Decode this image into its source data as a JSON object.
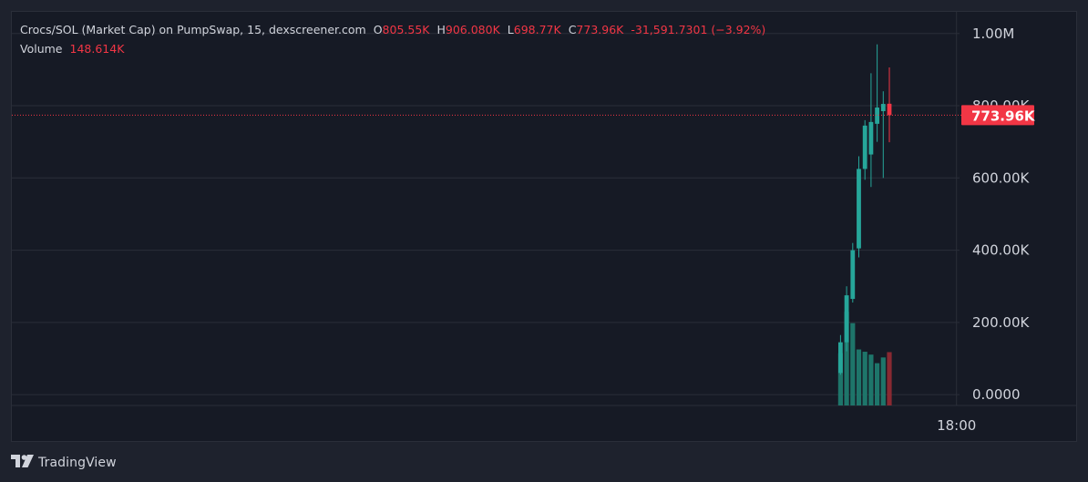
{
  "legend": {
    "title": "Crocs/SOL (Market Cap) on PumpSwap, 15, dexscreener.com",
    "open_label": "O",
    "open_value": "805.55K",
    "high_label": "H",
    "high_value": "906.080K",
    "low_label": "L",
    "low_value": "698.77K",
    "close_label": "C",
    "close_value": "773.96K",
    "change": "-31,591.7301 (−3.92%)",
    "volume_label": "Volume",
    "volume_value": "148.614K"
  },
  "price_tag": "773.96K",
  "footer": {
    "logo_icon": "tradingview-logo-icon",
    "brand": "TradingView"
  },
  "colors": {
    "background": "#161a25",
    "grid": "#2a2e39",
    "up": "#26a69a",
    "down": "#f23645",
    "axis_text": "#b2b5be"
  },
  "chart_data": {
    "type": "candlestick",
    "title": "Crocs/SOL (Market Cap) on PumpSwap, 15, dexscreener.com",
    "y_ticks": [
      {
        "value": 1000000,
        "label": "1.00M"
      },
      {
        "value": 800000,
        "label": "800.00K"
      },
      {
        "value": 600000,
        "label": "600.00K"
      },
      {
        "value": 400000,
        "label": "400.00K"
      },
      {
        "value": 200000,
        "label": "200.00K"
      },
      {
        "value": 0,
        "label": "0.0000"
      }
    ],
    "ylim": [
      -30000,
      1060000
    ],
    "x_ticks": [
      {
        "index": 19,
        "label": "18:00"
      }
    ],
    "x_range": [
      -172,
      24
    ],
    "current_price": 773960,
    "candles": [
      {
        "i": 0,
        "o": 60000,
        "h": 165000,
        "l": 55000,
        "c": 145000,
        "v": 145000
      },
      {
        "i": 1,
        "o": 145000,
        "h": 300000,
        "l": 120000,
        "c": 275000,
        "v": 290000
      },
      {
        "i": 2,
        "o": 265000,
        "h": 420000,
        "l": 255000,
        "c": 400000,
        "v": 250000
      },
      {
        "i": 3,
        "o": 405000,
        "h": 660000,
        "l": 380000,
        "c": 625000,
        "v": 158000
      },
      {
        "i": 4,
        "o": 625000,
        "h": 760000,
        "l": 595000,
        "c": 745000,
        "v": 150000
      },
      {
        "i": 5,
        "o": 665000,
        "h": 890000,
        "l": 575000,
        "c": 755000,
        "v": 140000
      },
      {
        "i": 6,
        "o": 750000,
        "h": 970000,
        "l": 700000,
        "c": 795000,
        "v": 110000
      },
      {
        "i": 7,
        "o": 785000,
        "h": 840000,
        "l": 600000,
        "c": 805000,
        "v": 130000
      },
      {
        "i": 8,
        "o": 805550,
        "h": 906080,
        "l": 698770,
        "c": 773960,
        "v": 148614
      }
    ],
    "volume_axis_max": 1060000
  }
}
